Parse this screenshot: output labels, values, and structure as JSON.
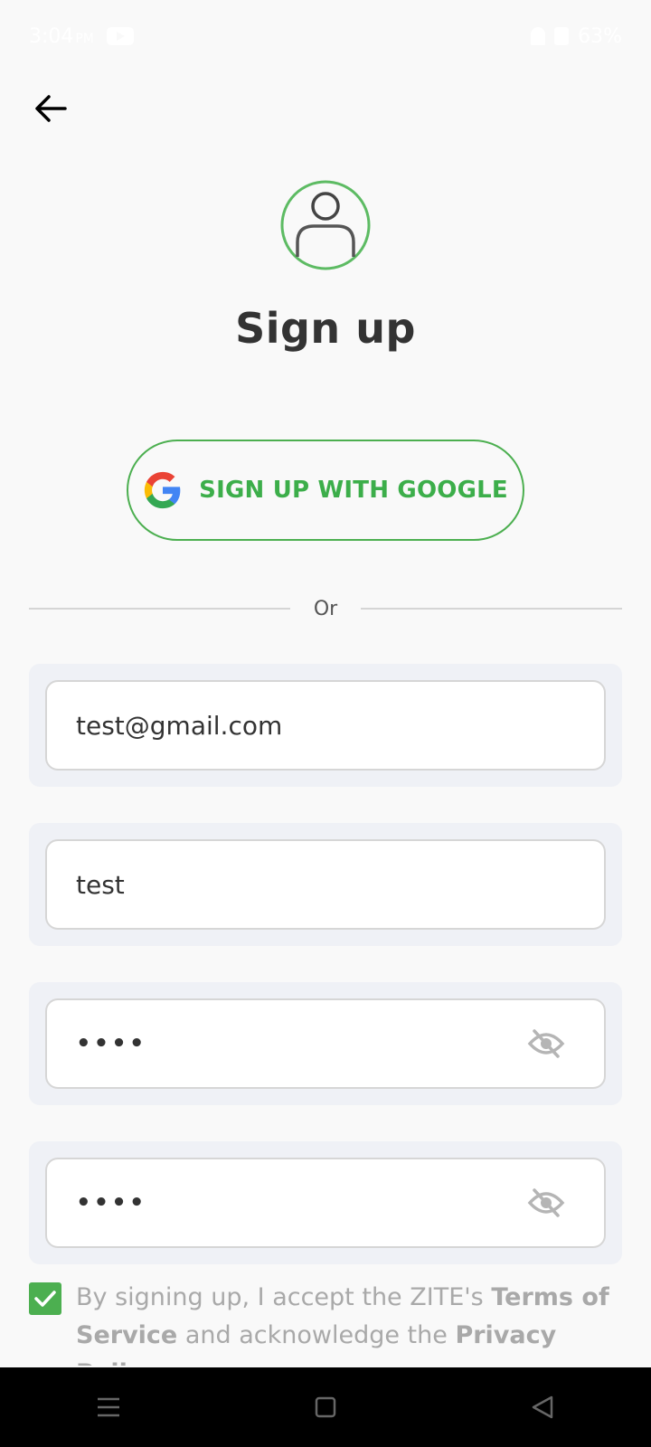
{
  "status_bar": {
    "time": "3:04",
    "ampm": "PM",
    "battery": "63%"
  },
  "header": {
    "title": "Sign up"
  },
  "google_button": {
    "label": "SIGN UP WITH GOOGLE"
  },
  "divider": {
    "label": "Or"
  },
  "fields": {
    "email_value": "test@gmail.com",
    "name_value": "test",
    "password_value": "••••",
    "confirm_password_value": "••••"
  },
  "terms": {
    "prefix": "By signing up, I accept the ZITE's ",
    "terms_link": "Terms of Service",
    "middle": " and  acknowledge the ",
    "privacy_link": "Privacy Policy"
  },
  "colors": {
    "accent": "#4caf50",
    "background": "#f9f9f9",
    "card": "#eff1f6"
  },
  "icons": {
    "back": "arrow-left-icon",
    "avatar": "user-icon",
    "google": "google-g-icon",
    "eye": "eye-off-icon",
    "check": "checkmark-icon"
  }
}
